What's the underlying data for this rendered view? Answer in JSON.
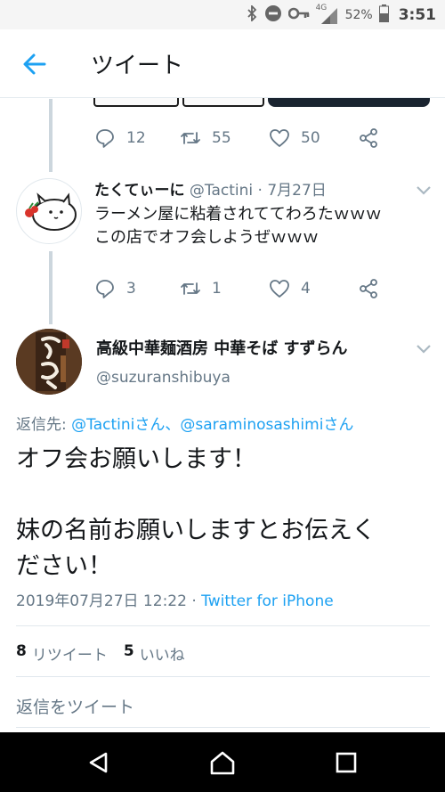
{
  "status_bar": {
    "network": "4G",
    "battery": "52%",
    "time": "3:51",
    "icons": [
      "bluetooth-icon",
      "do-not-disturb-icon",
      "vpn-key-icon",
      "signal-icon",
      "battery-icon"
    ]
  },
  "app_bar": {
    "title": "ツイート",
    "back_icon": "back-arrow-icon"
  },
  "prev_tweet_actions": {
    "replies": "12",
    "retweets": "55",
    "likes": "50"
  },
  "reply_tweet": {
    "name": "たくてぃーに",
    "handle_date": "@Tactini · 7月27日",
    "text": "ラーメン屋に粘着されててわろたｗｗｗ\nこの店でオフ会しようぜｗｗｗ",
    "replies": "3",
    "retweets": "1",
    "likes": "4"
  },
  "main_tweet": {
    "name": "高級中華麺酒房 中華そば すずらん",
    "handle": "@suzuranshibuya",
    "reply_label": "返信先: ",
    "reply_users": "@Tactiniさん、@saraminosashimiさん",
    "text": "オフ会お願いします！\n\n妹の名前お願いしますとお伝えく\nださい！",
    "timestamp": "2019年07月27日 12:22 · ",
    "client": "Twitter for iPhone",
    "retweet_count": "8",
    "retweet_label": "リツイート",
    "like_count": "5",
    "like_label": "いいね",
    "reply_prompt": "返信をツイート"
  },
  "colors": {
    "accent": "#1da1f2",
    "secondary_text": "#657786",
    "divider": "#e1e8ed"
  }
}
